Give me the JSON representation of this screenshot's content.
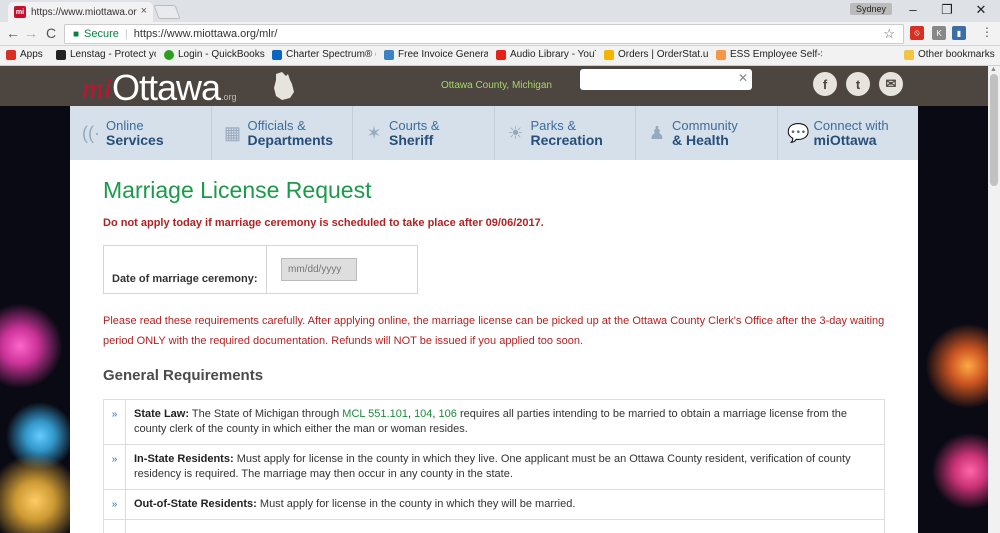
{
  "browser": {
    "tab_title": "https://www.miottawa.or",
    "tab_close": "×",
    "profile": "Sydney",
    "window_controls": [
      "–",
      "❐",
      "✕"
    ],
    "nav": {
      "back": "←",
      "forward": "→",
      "reload": "C"
    },
    "secure_label": "Secure",
    "separator": "|",
    "url": "https://www.miottawa.org/mlr/",
    "bookmarks": [
      {
        "label": "Apps",
        "color": "#d93025"
      },
      {
        "label": "Lenstag - Protect you",
        "color": "#222222"
      },
      {
        "label": "Login - QuickBooks S",
        "color": "#2ca01c"
      },
      {
        "label": "Charter Spectrum® (",
        "color": "#0a66c2"
      },
      {
        "label": "Free Invoice Generat",
        "color": "#3b82c4"
      },
      {
        "label": "Audio Library - YouTu",
        "color": "#e62117"
      },
      {
        "label": "Orders | OrderStat.us",
        "color": "#f4b400"
      },
      {
        "label": "ESS Employee Self-Se",
        "color": "#f79646"
      }
    ],
    "other_bookmarks": "Other bookmarks"
  },
  "site": {
    "logo": {
      "mi": "mi",
      "ottawa": "Ottawa",
      "org": ".org"
    },
    "county": "Ottawa County, Michigan",
    "social": {
      "facebook": "f",
      "twitter": "t",
      "mail": "✉"
    },
    "nav": [
      {
        "top": "Online",
        "bottom": "Services",
        "icon": "wifi-icon",
        "glyph": "((·"
      },
      {
        "top": "Officials &",
        "bottom": "Departments",
        "icon": "building-icon",
        "glyph": "▦"
      },
      {
        "top": "Courts &",
        "bottom": "Sheriff",
        "icon": "star-icon",
        "glyph": "✶"
      },
      {
        "top": "Parks &",
        "bottom": "Recreation",
        "icon": "sun-icon",
        "glyph": "☀"
      },
      {
        "top": "Community",
        "bottom": "& Health",
        "icon": "people-icon",
        "glyph": "♟"
      },
      {
        "top": "Connect with",
        "bottom": "miOttawa",
        "icon": "chat-icon",
        "glyph": "💬"
      }
    ],
    "page_title": "Marriage License Request",
    "warning": "Do not apply today if marriage ceremony is scheduled to take place after 09/06/2017.",
    "date_label": "Date of marriage ceremony:",
    "date_placeholder": "mm/dd/yyyy",
    "notice": "Please read these requirements carefully. After applying online, the marriage license can be picked up at the Ottawa County Clerk's Office after the 3-day waiting period ONLY with the required documentation. Refunds will NOT be issued if you applied too soon.",
    "general_heading": "General Requirements",
    "bullet": "»",
    "requirements": {
      "state_law": {
        "label": "State Law:",
        "pre": " The State of Michigan through ",
        "link1": "MCL 551.101",
        "comma1": ", ",
        "link2": "104",
        "comma2": ", ",
        "link3": "106",
        "post": " requires all parties intending to be married to obtain a marriage license from the county clerk of the county in which either the man or woman resides."
      },
      "in_state": {
        "label": "In-State Residents:",
        "text": " Must apply for license in the county in which they live. One applicant must be an Ottawa County resident, verification of county residency is required. The marriage may then occur in any county in the state."
      },
      "out_of_state": {
        "label": "Out-of-State Residents:",
        "text": " Must apply for license in the county in which they will be married."
      }
    }
  }
}
